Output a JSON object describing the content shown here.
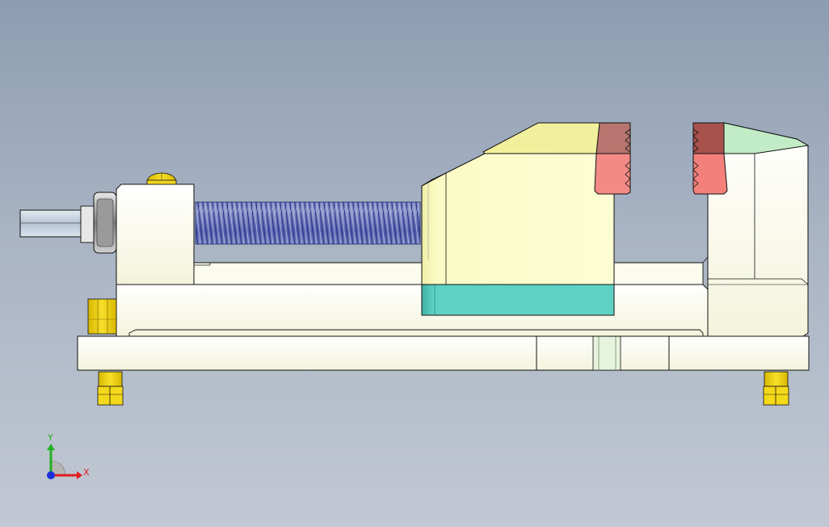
{
  "viewport": {
    "background_top": "#8d9db1",
    "background_bottom": "#c2c8d3"
  },
  "model": {
    "colors": {
      "body": "#fbfbe9",
      "movable_jaw": "#fbfbc6",
      "movable_jaw_top": "#f1f19d",
      "jaw_base": "#5dd1c4",
      "jaw_plate_top": "#b8746f",
      "jaw_plate_bottom": "#f48a86",
      "fixed_plate_top": "#a8524e",
      "fixed_plate_bottom": "#f4807c",
      "fixed_jaw_top": "#c2ecc6",
      "thread": "#4f5aa8",
      "screw_head": "#c6d0dc",
      "fastener": "#f4d81a",
      "outline": "#111111"
    },
    "icons": [
      "hex-screw-end-icon",
      "washer-icon",
      "lead-screw-icon",
      "bolt-icon",
      "foot-icon"
    ]
  },
  "triad": {
    "x_label": "X",
    "y_label": "Y",
    "x_color": "#e02020",
    "y_color": "#22b022",
    "z_color": "#1a2fd8"
  }
}
